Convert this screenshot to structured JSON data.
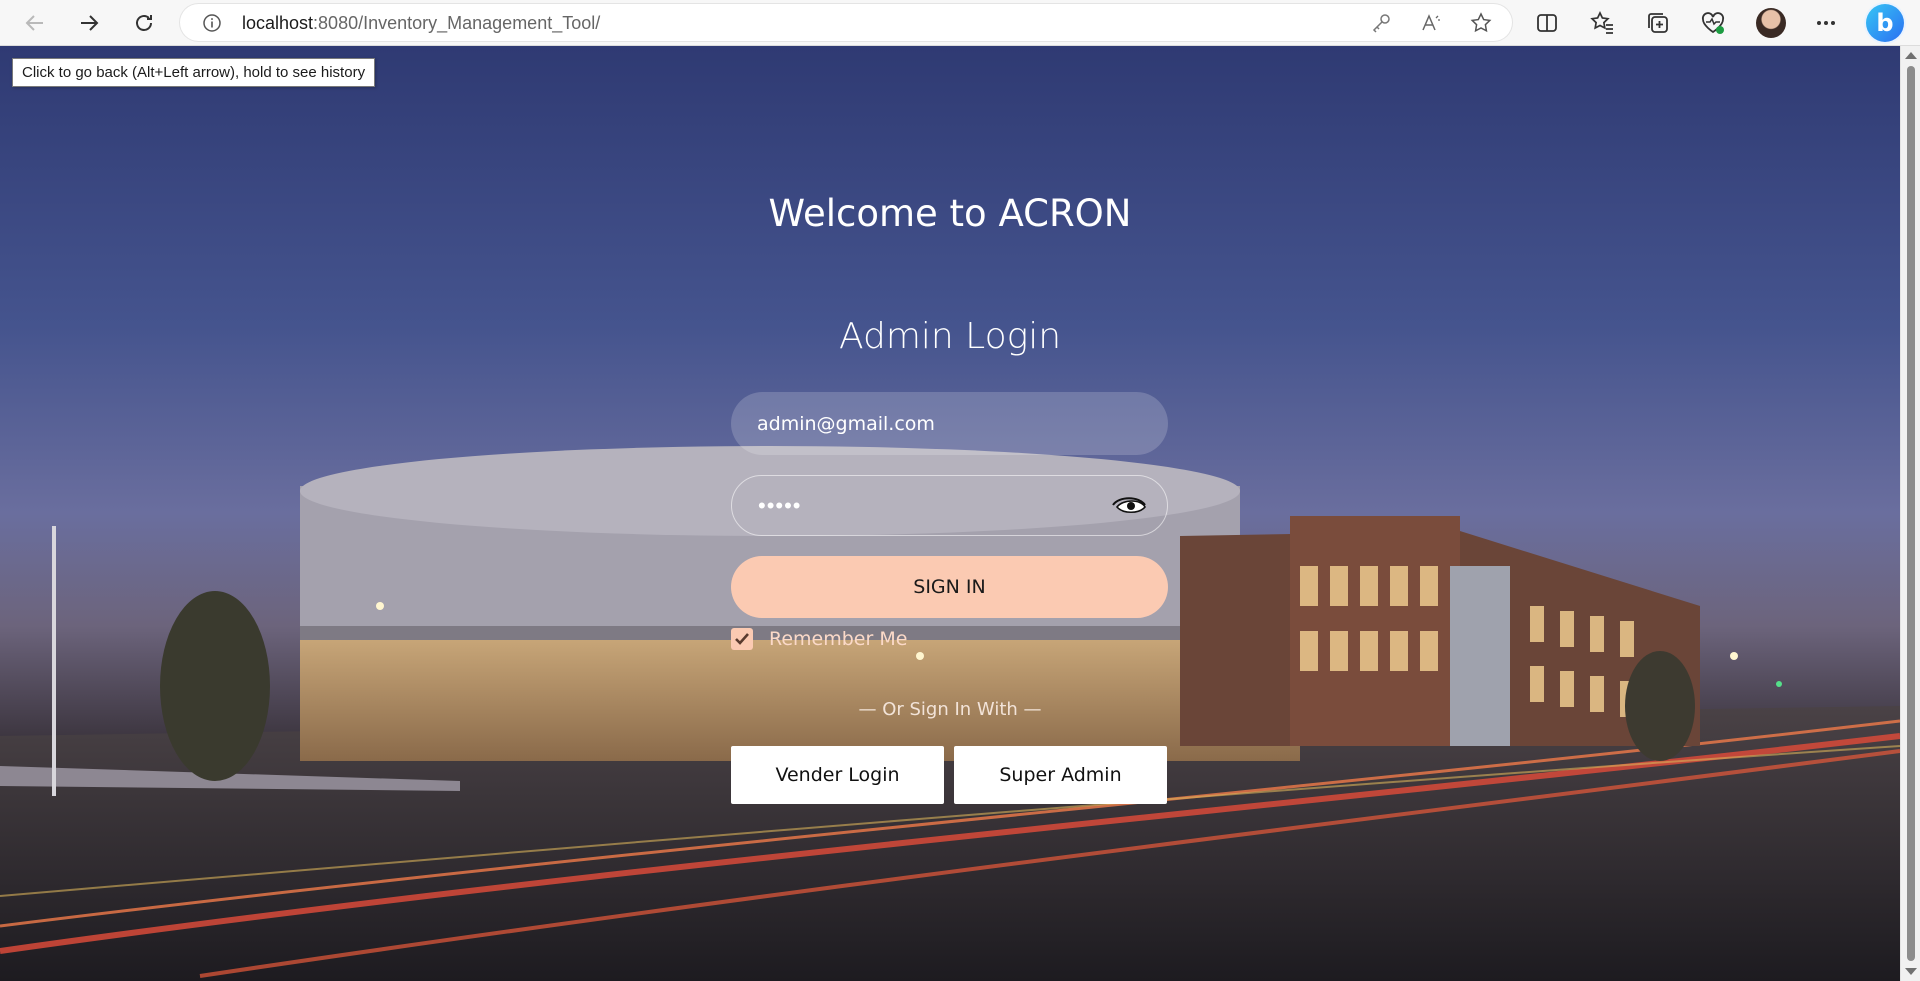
{
  "browser": {
    "url_host": "localhost",
    "url_rest": ":8080/Inventory_Management_Tool/",
    "tooltip": "Click to go back (Alt+Left arrow), hold to see history",
    "icons": [
      "back-icon",
      "forward-icon",
      "refresh-icon",
      "info-icon",
      "key-icon",
      "read-aloud-icon",
      "favorite-star-icon",
      "split-screen-icon",
      "favorites-icon",
      "collections-icon",
      "browser-essentials-icon",
      "profile-avatar-icon",
      "more-menu-icon",
      "bing-copilot-icon"
    ],
    "bing_letter": "b"
  },
  "page": {
    "welcome": "Welcome to ACRON",
    "title": "Admin Login",
    "email_value": "admin@gmail.com",
    "password_value": "•••••",
    "signin_label": "SIGN IN",
    "remember_label": "Remember Me",
    "remember_checked": true,
    "or_text": "— Or Sign In With —",
    "vendor_label": "Vender Login",
    "super_admin_label": "Super Admin"
  },
  "colors": {
    "accent_peach": "#fbcab2",
    "sky": "#3b4a86",
    "white": "#ffffff"
  }
}
